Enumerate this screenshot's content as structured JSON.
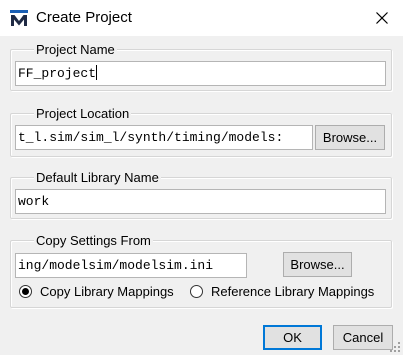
{
  "window": {
    "title": "Create Project",
    "icon": "modelsim-m-icon",
    "close_icon": "close-icon"
  },
  "project_name": {
    "label": "Project Name",
    "value": "FF_project"
  },
  "project_location": {
    "label": "Project Location",
    "value": "t_l.sim/sim_l/synth/timing/models:",
    "browse_label": "Browse..."
  },
  "default_library": {
    "label": "Default Library Name",
    "value": "work"
  },
  "copy_settings": {
    "label": "Copy Settings From",
    "value": "ing/modelsim/modelsim.ini",
    "browse_label": "Browse...",
    "option_copy": "Copy Library Mappings",
    "option_reference": "Reference Library Mappings",
    "selected": "copy"
  },
  "buttons": {
    "ok": "OK",
    "cancel": "Cancel"
  },
  "colors": {
    "title_icon_bar": "#1a5fb4",
    "accent": "#0078d7",
    "dialog_bg": "#f0f0f0"
  }
}
